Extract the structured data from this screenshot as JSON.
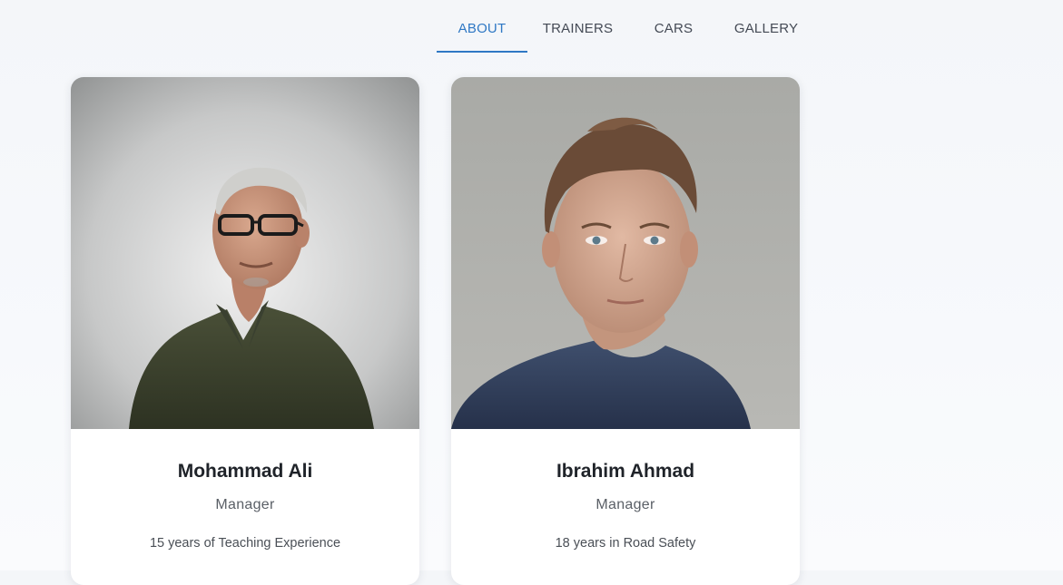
{
  "nav": {
    "tabs": [
      {
        "label": "ABOUT",
        "active": true
      },
      {
        "label": "TRAINERS",
        "active": false
      },
      {
        "label": "CARS",
        "active": false
      },
      {
        "label": "GALLERY",
        "active": false
      }
    ]
  },
  "accent_color": "#2f78c4",
  "trainers": [
    {
      "name": "Mohammad Ali",
      "role": "Manager",
      "description": "15 years of Teaching Experience"
    },
    {
      "name": "Ibrahim Ahmad",
      "role": "Manager",
      "description": "18 years in Road Safety"
    }
  ]
}
